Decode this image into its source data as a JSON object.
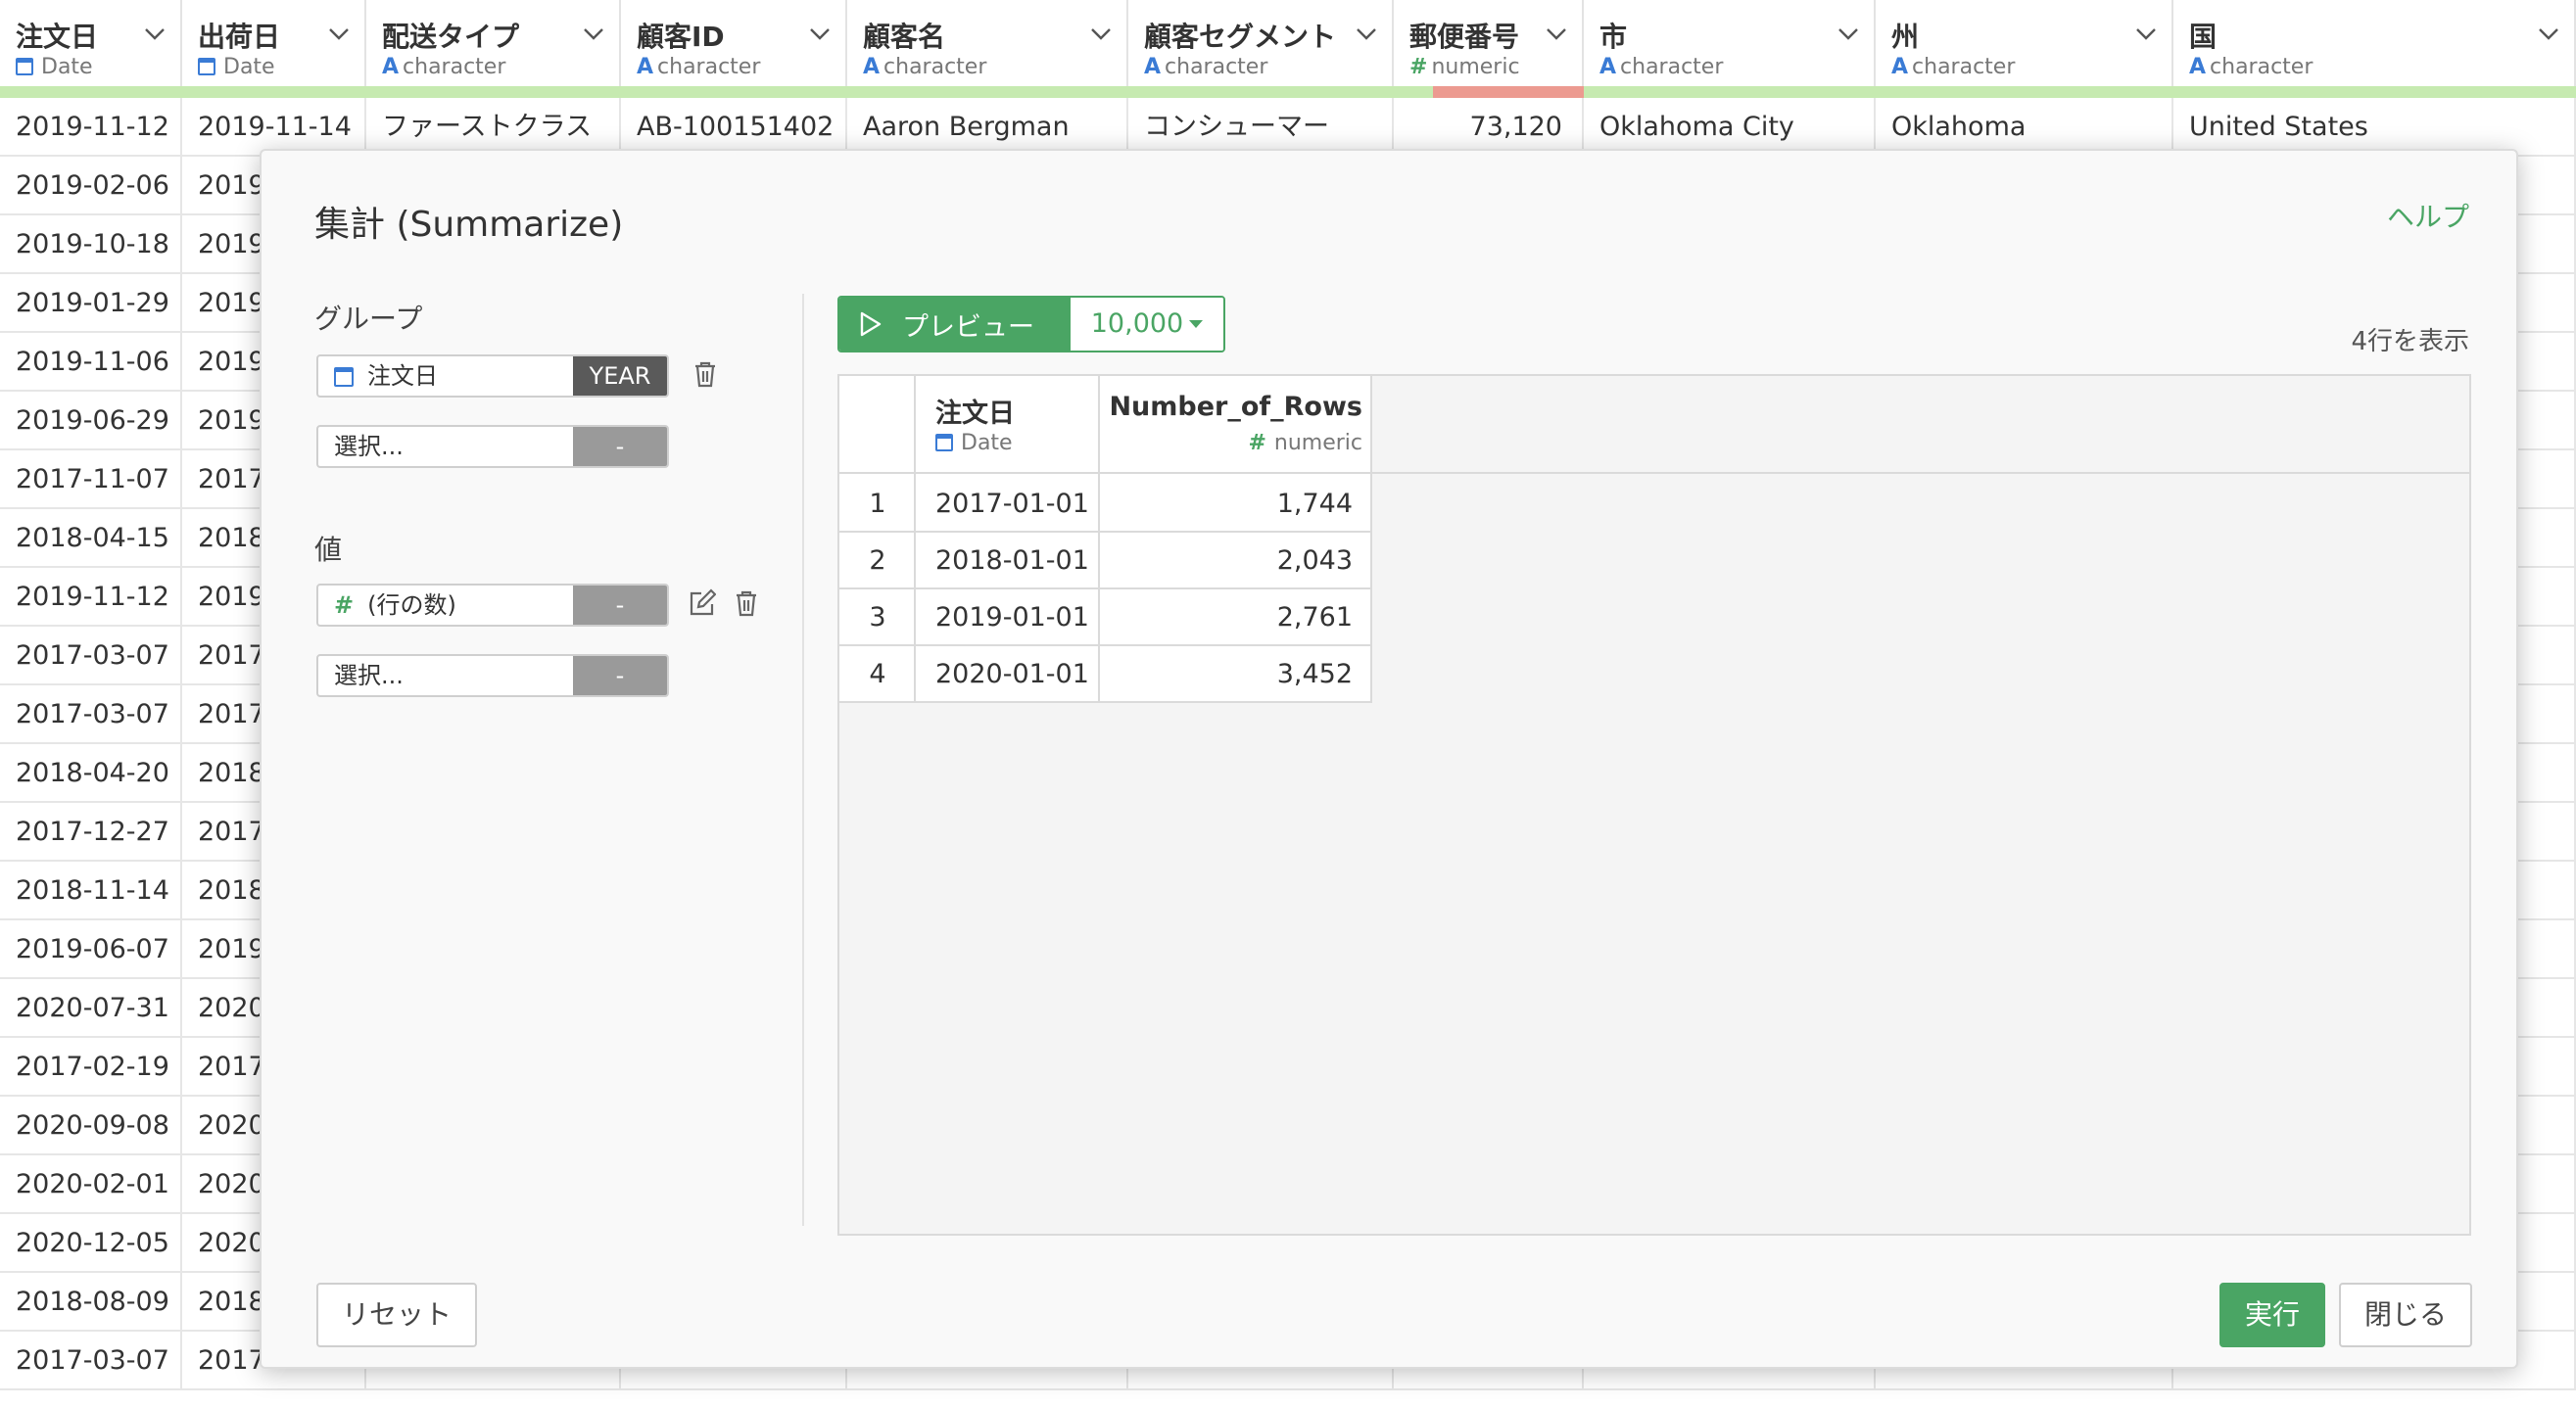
{
  "grid": {
    "columns": [
      {
        "name": "注文日",
        "type": "Date",
        "type_icon": "calendar-icon"
      },
      {
        "name": "出荷日",
        "type": "Date",
        "type_icon": "calendar-icon"
      },
      {
        "name": "配送タイプ",
        "type": "character",
        "type_icon": "A"
      },
      {
        "name": "顧客ID",
        "type": "character",
        "type_icon": "A"
      },
      {
        "name": "顧客名",
        "type": "character",
        "type_icon": "A"
      },
      {
        "name": "顧客セグメント",
        "type": "character",
        "type_icon": "A"
      },
      {
        "name": "郵便番号",
        "type": "numeric",
        "type_icon": "#"
      },
      {
        "name": "市",
        "type": "character",
        "type_icon": "A"
      },
      {
        "name": "州",
        "type": "character",
        "type_icon": "A"
      },
      {
        "name": "国",
        "type": "character",
        "type_icon": "A"
      }
    ],
    "first_row": [
      "2019-11-12",
      "2019-11-14",
      "ファーストクラス",
      "AB-100151402",
      "Aaron Bergman",
      "コンシューマー",
      "73,120",
      "Oklahoma City",
      "Oklahoma",
      "United States"
    ],
    "order_dates": [
      "2019-02-06",
      "2019-10-18",
      "2019-01-29",
      "2019-11-06",
      "2019-06-29",
      "2017-11-07",
      "2018-04-15",
      "2019-11-12",
      "2017-03-07",
      "2017-03-07",
      "2018-04-20",
      "2017-12-27",
      "2018-11-14",
      "2019-06-07",
      "2020-07-31",
      "2017-02-19",
      "2020-09-08",
      "2020-02-01",
      "2020-12-05",
      "2018-08-09",
      "2017-03-07"
    ],
    "ship_dates_partial": [
      "2019",
      "2019",
      "2019",
      "2019",
      "2019",
      "2017",
      "2018",
      "2019",
      "2017",
      "2017",
      "2018",
      "2017",
      "2018",
      "2019",
      "2020",
      "2017",
      "2020",
      "2020",
      "2020",
      "2018",
      "2017"
    ]
  },
  "modal": {
    "title": "集計 (Summarize)",
    "help": "ヘルプ",
    "group_label": "グループ",
    "group_item": {
      "column": "注文日",
      "function": "YEAR"
    },
    "group_placeholder": "選択...",
    "group_placeholder_btn": "-",
    "value_label": "値",
    "value_item": {
      "column": "(行の数)",
      "function": "-"
    },
    "value_placeholder": "選択...",
    "value_placeholder_btn": "-",
    "preview_button": "プレビュー",
    "preview_limit": "10,000",
    "rows_shown": "4行を表示",
    "preview_table": {
      "columns": [
        {
          "name": "注文日",
          "type": "Date"
        },
        {
          "name": "Number_of_Rows",
          "type": "numeric"
        }
      ],
      "rows": [
        {
          "index": "1",
          "date": "2017-01-01",
          "count": "1,744"
        },
        {
          "index": "2",
          "date": "2018-01-01",
          "count": "2,043"
        },
        {
          "index": "3",
          "date": "2019-01-01",
          "count": "2,761"
        },
        {
          "index": "4",
          "date": "2020-01-01",
          "count": "3,452"
        }
      ]
    },
    "reset_button": "リセット",
    "run_button": "実行",
    "close_button": "閉じる"
  },
  "colors": {
    "accent_green": "#4aa564",
    "date_blue": "#3a7bd5",
    "missing_red": "#ec9a90",
    "quality_green": "#c6eab0"
  }
}
